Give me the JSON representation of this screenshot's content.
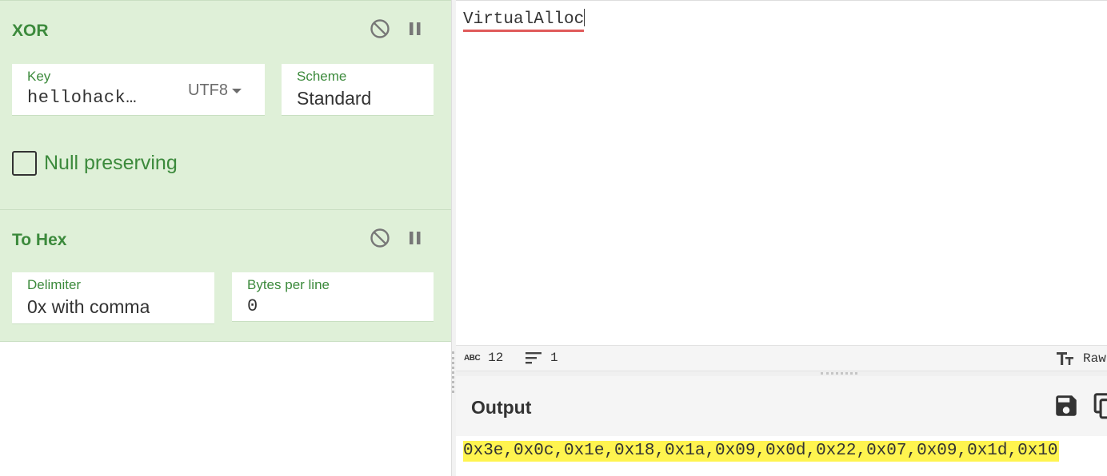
{
  "recipe": {
    "xor": {
      "title": "XOR",
      "disable_icon": "disable-icon",
      "pause_icon": "pause-icon",
      "key": {
        "label": "Key",
        "value": "hellohack…",
        "encoding": "UTF8"
      },
      "scheme": {
        "label": "Scheme",
        "value": "Standard"
      },
      "null_preserving": {
        "label": "Null preserving",
        "checked": false
      }
    },
    "to_hex": {
      "title": "To Hex",
      "delimiter": {
        "label": "Delimiter",
        "value": "0x with comma"
      },
      "bytes_per_line": {
        "label": "Bytes per line",
        "value": "0"
      }
    }
  },
  "input": {
    "text": "VirtualAlloc",
    "status": {
      "chars": "12",
      "lines": "1",
      "mode": "Raw"
    }
  },
  "output": {
    "title": "Output",
    "text": "0x3e,0x0c,0x1e,0x18,0x1a,0x09,0x0d,0x22,0x07,0x09,0x1d,0x10"
  },
  "colors": {
    "operation_bg": "#dff0d8",
    "operation_title": "#3c8a3c",
    "output_highlight": "#fff44f",
    "spell_underline": "#e05a5a"
  }
}
